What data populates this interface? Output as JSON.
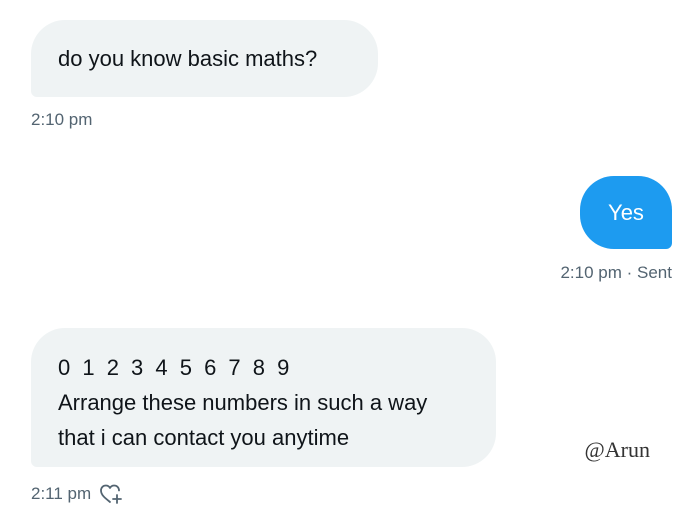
{
  "messages": [
    {
      "direction": "received",
      "text": "do you know basic maths?",
      "time": "2:10 pm"
    },
    {
      "direction": "sent",
      "text": "Yes",
      "time": "2:10 pm",
      "status": "Sent",
      "separator": "·"
    },
    {
      "direction": "received",
      "line1": "0 1 2 3 4 5 6 7 8 9",
      "line2": "Arrange these numbers in such a way",
      "line3": "that i can contact you anytime",
      "time": "2:11 pm",
      "reaction_icon": "heart-plus-icon"
    }
  ],
  "watermark": "@Arun",
  "colors": {
    "received_bubble": "#eff3f4",
    "sent_bubble": "#1d9bf0",
    "meta_text": "#536471"
  }
}
